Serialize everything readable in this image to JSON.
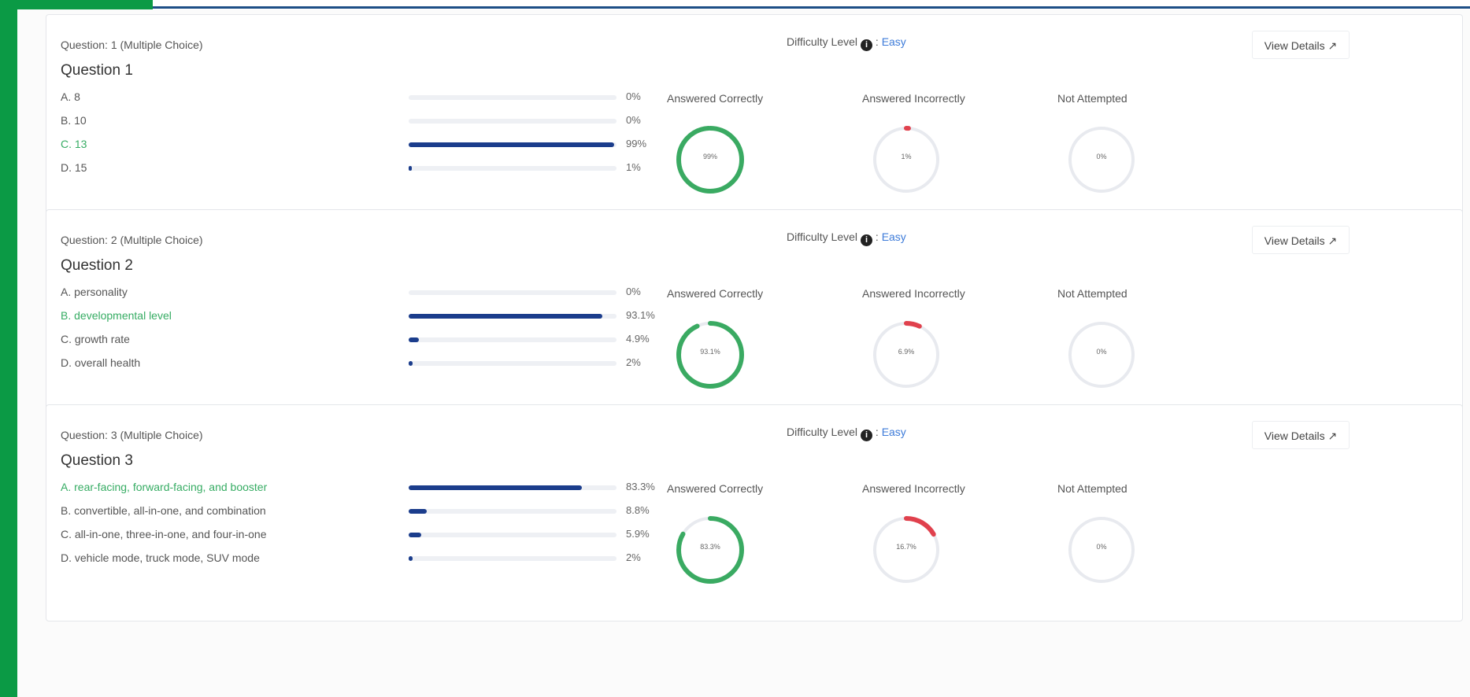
{
  "questions": [
    {
      "meta": "Question: 1 (Multiple Choice)",
      "title": "Question 1",
      "difficulty_label": "Difficulty Level",
      "difficulty_value": "Easy",
      "view_details": "View Details ↗",
      "options": [
        {
          "text": "A. 8",
          "percent_label": "0%",
          "percent": 0,
          "correct": false
        },
        {
          "text": "B. 10",
          "percent_label": "0%",
          "percent": 0,
          "correct": false
        },
        {
          "text": "C. 13",
          "percent_label": "99%",
          "percent": 99,
          "correct": true
        },
        {
          "text": "D. 15",
          "percent_label": "1%",
          "percent": 1,
          "correct": false
        }
      ],
      "stats": {
        "correct": {
          "label": "Answered Correctly",
          "value_label": "99%",
          "value": 99
        },
        "incorrect": {
          "label": "Answered Incorrectly",
          "value_label": "1%",
          "value": 1
        },
        "not_attempted": {
          "label": "Not Attempted",
          "value_label": "0%",
          "value": 0
        }
      }
    },
    {
      "meta": "Question: 2 (Multiple Choice)",
      "title": "Question 2",
      "difficulty_label": "Difficulty Level",
      "difficulty_value": "Easy",
      "view_details": "View Details ↗",
      "options": [
        {
          "text": "A. personality",
          "percent_label": "0%",
          "percent": 0,
          "correct": false
        },
        {
          "text": "B. developmental level",
          "percent_label": "93.1%",
          "percent": 93.1,
          "correct": true
        },
        {
          "text": "C. growth rate",
          "percent_label": "4.9%",
          "percent": 4.9,
          "correct": false
        },
        {
          "text": "D. overall health",
          "percent_label": "2%",
          "percent": 2,
          "correct": false
        }
      ],
      "stats": {
        "correct": {
          "label": "Answered Correctly",
          "value_label": "93.1%",
          "value": 93.1
        },
        "incorrect": {
          "label": "Answered Incorrectly",
          "value_label": "6.9%",
          "value": 6.9
        },
        "not_attempted": {
          "label": "Not Attempted",
          "value_label": "0%",
          "value": 0
        }
      }
    },
    {
      "meta": "Question: 3 (Multiple Choice)",
      "title": "Question 3",
      "difficulty_label": "Difficulty Level",
      "difficulty_value": "Easy",
      "view_details": "View Details ↗",
      "options": [
        {
          "text": "A. rear-facing, forward-facing, and booster",
          "percent_label": "83.3%",
          "percent": 83.3,
          "correct": true
        },
        {
          "text": "B. convertible, all-in-one, and combination",
          "percent_label": "8.8%",
          "percent": 8.8,
          "correct": false
        },
        {
          "text": "C. all-in-one, three-in-one, and four-in-one",
          "percent_label": "5.9%",
          "percent": 5.9,
          "correct": false
        },
        {
          "text": "D. vehicle mode, truck mode, SUV mode",
          "percent_label": "2%",
          "percent": 2,
          "correct": false
        }
      ],
      "stats": {
        "correct": {
          "label": "Answered Correctly",
          "value_label": "83.3%",
          "value": 83.3
        },
        "incorrect": {
          "label": "Answered Incorrectly",
          "value_label": "16.7%",
          "value": 16.7
        },
        "not_attempted": {
          "label": "Not Attempted",
          "value_label": "0%",
          "value": 0
        }
      }
    }
  ],
  "colors": {
    "sidebar": "#0b9a45",
    "bar_fill": "#1b3d8c",
    "correct_ring": "#3aaa62",
    "incorrect_ring": "#e0414d",
    "ring_track": "#e8eaef",
    "correct_text": "#36ac63",
    "difficulty_easy": "#3d7bd9"
  }
}
